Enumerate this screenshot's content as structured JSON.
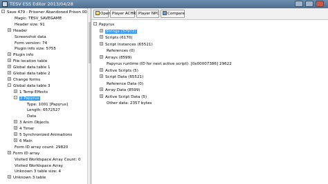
{
  "window": {
    "title": "TESV ESS Editor 2013/04/28"
  },
  "toolbar": {
    "open": "Open",
    "player_achr": "Player ACHR",
    "player_npc": "Player NPC",
    "compare": "Compare"
  },
  "left_tree": [
    {
      "text": "Save 479 - Prisoner  Abandoned Prison  00.22",
      "level": 0,
      "exp": "-"
    },
    {
      "text": "Magic: TESV_SAVEGAME",
      "level": 1,
      "exp": ""
    },
    {
      "text": "Header size: 91",
      "level": 1,
      "exp": ""
    },
    {
      "text": "Header",
      "level": 1,
      "exp": "+"
    },
    {
      "text": "Screenshot data",
      "level": 1,
      "exp": ""
    },
    {
      "text": "Form version: 74",
      "level": 1,
      "exp": ""
    },
    {
      "text": "Plugin info size: 5755",
      "level": 1,
      "exp": ""
    },
    {
      "text": "Plugin info",
      "level": 1,
      "exp": "+"
    },
    {
      "text": "File location table",
      "level": 1,
      "exp": "+"
    },
    {
      "text": "Global data table 1",
      "level": 1,
      "exp": "+"
    },
    {
      "text": "Global data table 2",
      "level": 1,
      "exp": "+"
    },
    {
      "text": "Change forms",
      "level": 1,
      "exp": "+"
    },
    {
      "text": "Global data table 3",
      "level": 1,
      "exp": "-"
    },
    {
      "text": "1 Temp Effects",
      "level": 2,
      "exp": "+"
    },
    {
      "text": "2 Papyrus",
      "level": 2,
      "exp": "-",
      "selected": true
    },
    {
      "text": "Type: 1001 [Papyrus]",
      "level": 3,
      "exp": ""
    },
    {
      "text": "Length: 6572527",
      "level": 3,
      "exp": ""
    },
    {
      "text": "Data",
      "level": 3,
      "exp": ""
    },
    {
      "text": "3 Anim Objects",
      "level": 2,
      "exp": "+"
    },
    {
      "text": "4 Timer",
      "level": 2,
      "exp": "+"
    },
    {
      "text": "5 Synchronized Animations",
      "level": 2,
      "exp": "+"
    },
    {
      "text": "6 Main",
      "level": 2,
      "exp": "+"
    },
    {
      "text": "Form ID array count: 29820",
      "level": 1,
      "exp": ""
    },
    {
      "text": "Form ID array",
      "level": 1,
      "exp": "+"
    },
    {
      "text": "Visited Worldspace Array Count: 0",
      "level": 1,
      "exp": ""
    },
    {
      "text": "Visited Worldspace Array",
      "level": 1,
      "exp": ""
    },
    {
      "text": "Unknown 3 table size: 4",
      "level": 1,
      "exp": ""
    },
    {
      "text": "Unknown 3 table",
      "level": 1,
      "exp": "+"
    }
  ],
  "right_tree": [
    {
      "text": "Papyrus",
      "level": 0,
      "exp": "-"
    },
    {
      "text": "Strings (37972)",
      "level": 1,
      "exp": "+",
      "selected": true
    },
    {
      "text": "Scripts (6170)",
      "level": 1,
      "exp": "+"
    },
    {
      "text": "Script Instances (65521)",
      "level": 1,
      "exp": "+"
    },
    {
      "text": "References (0)",
      "level": 1,
      "exp": ""
    },
    {
      "text": "Arrays (8599)",
      "level": 1,
      "exp": "+"
    },
    {
      "text": "Papyrus runtime (ID for next active script): [0x00007386] 29622",
      "level": 1,
      "exp": ""
    },
    {
      "text": "Active Scripts (5)",
      "level": 1,
      "exp": "+"
    },
    {
      "text": "Script Data (65521)",
      "level": 1,
      "exp": "+"
    },
    {
      "text": "Reference Data (0)",
      "level": 1,
      "exp": ""
    },
    {
      "text": "Array Data (8599)",
      "level": 1,
      "exp": "+"
    },
    {
      "text": "Active Script Data (5)",
      "level": 1,
      "exp": "+"
    },
    {
      "text": "Other data: 2357 bytes",
      "level": 1,
      "exp": ""
    }
  ]
}
